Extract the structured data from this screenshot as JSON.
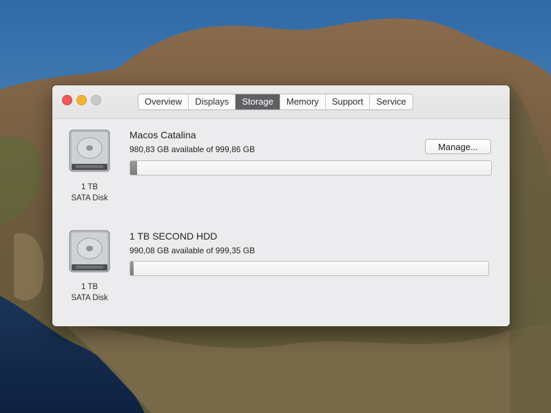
{
  "window": {
    "tabs": [
      {
        "label": "Overview"
      },
      {
        "label": "Displays"
      },
      {
        "label": "Storage"
      },
      {
        "label": "Memory"
      },
      {
        "label": "Support"
      },
      {
        "label": "Service"
      }
    ],
    "active_tab": "Storage"
  },
  "disks": [
    {
      "name": "Macos Catalina",
      "availability": "980,83 GB available of 999,86 GB",
      "caption_size": "1 TB",
      "caption_type": "SATA Disk",
      "used_fraction": 0.019,
      "manage_label": "Manage..."
    },
    {
      "name": "1 TB SECOND HDD",
      "availability": "990,08 GB available of 999,35 GB",
      "caption_size": "1 TB",
      "caption_type": "SATA Disk",
      "used_fraction": 0.009
    }
  ],
  "colors": {
    "active_tab": "#5f6063",
    "close": "#ec5a55",
    "minimize": "#f4b433",
    "zoom_disabled": "#c9c9cb"
  }
}
